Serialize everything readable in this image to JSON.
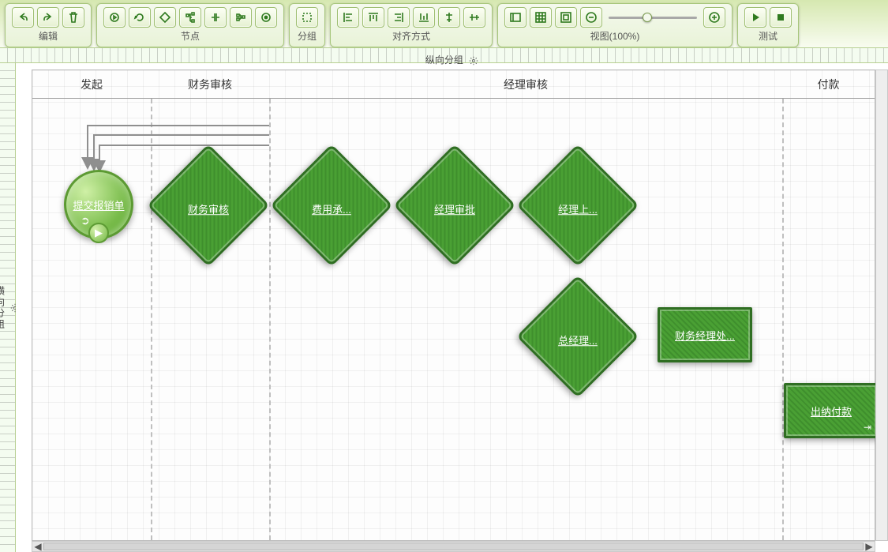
{
  "toolbar": {
    "edit": {
      "label": "编辑"
    },
    "node": {
      "label": "节点"
    },
    "group": {
      "label": "分组"
    },
    "align": {
      "label": "对齐方式"
    },
    "view": {
      "label": "视图(100%)"
    },
    "test": {
      "label": "测试"
    }
  },
  "group_titles": {
    "vertical": "纵向分组",
    "horizontal": "横向分组"
  },
  "lanes": [
    "发起",
    "财务审核",
    "经理审核",
    "付款"
  ],
  "nodes": {
    "start": "提交报销单",
    "finance": "财务审核",
    "cost": "费用承...",
    "mgr_appr": "经理审批",
    "mgr_up": "经理上...",
    "gm": "总经理...",
    "fin_mgr": "财务经理处...",
    "pay": "出纳付款"
  }
}
